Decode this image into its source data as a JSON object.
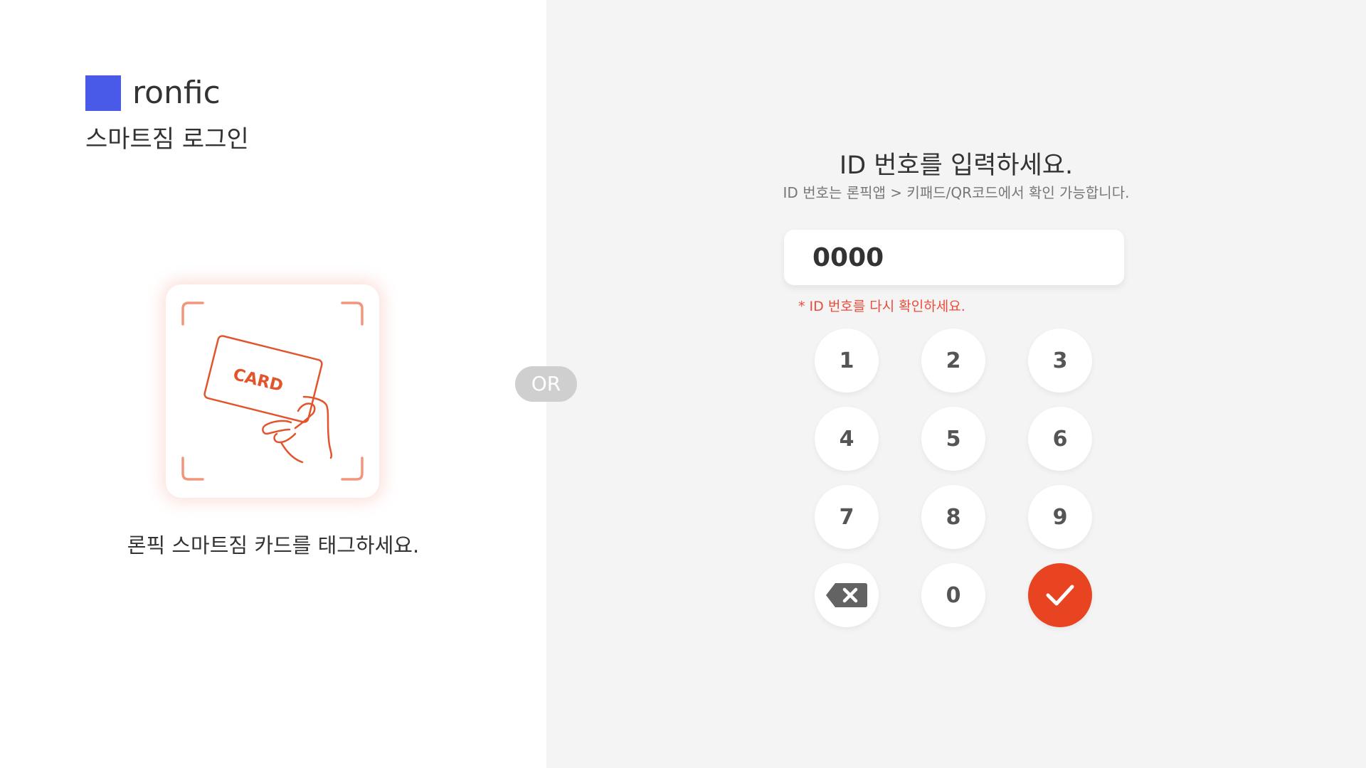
{
  "brand": {
    "name": "ronfic",
    "subtitle": "스마트짐 로그인",
    "color": "#4a5ae8"
  },
  "card_login": {
    "card_text": "CARD",
    "caption": "론픽 스마트짐 카드를 태그하세요.",
    "accent_color": "#e2542c"
  },
  "separator": {
    "label": "OR"
  },
  "id_login": {
    "title": "ID 번호를 입력하세요.",
    "help": "ID 번호는 론픽앱 > 키패드/QR코드에서 확인 가능합니다.",
    "input_value": "0000",
    "error": "* ID 번호를 다시 확인하세요."
  },
  "keypad": {
    "keys": [
      "1",
      "2",
      "3",
      "4",
      "5",
      "6",
      "7",
      "8",
      "9",
      "0"
    ],
    "backspace_icon": "backspace-icon",
    "confirm_icon": "checkmark-icon",
    "confirm_color": "#e94421"
  }
}
